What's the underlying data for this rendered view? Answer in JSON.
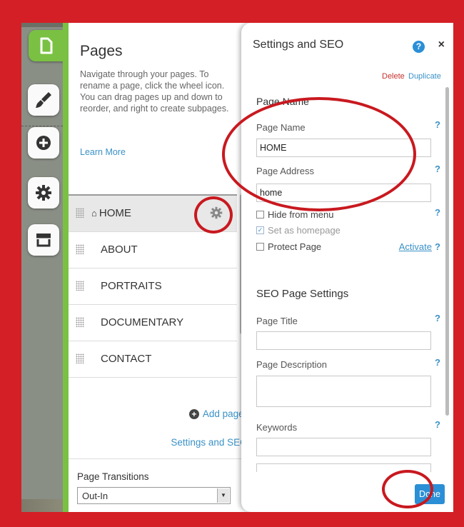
{
  "rail": {
    "items": [
      {
        "name": "pages-icon",
        "active": true
      },
      {
        "name": "design-icon"
      },
      {
        "name": "add-icon"
      },
      {
        "name": "settings-gear-icon"
      },
      {
        "name": "store-icon"
      }
    ]
  },
  "pages_panel": {
    "title": "Pages",
    "close": "×",
    "description": "Navigate through your pages. To rename a page, click the wheel icon. You can drag pages up and down to reorder, and right to create subpages.",
    "learn_more": "Learn More",
    "items": [
      {
        "label": "HOME",
        "home": true,
        "selected": true
      },
      {
        "label": "ABOUT"
      },
      {
        "label": "PORTRAITS"
      },
      {
        "label": "DOCUMENTARY"
      },
      {
        "label": "CONTACT"
      }
    ],
    "home_icon": "⌂",
    "add_page": "Add page",
    "settings_seo": "Settings and SEO",
    "chevron": "›",
    "transitions_label": "Page Transitions",
    "transitions_help": "?",
    "transitions_value": "Out-In"
  },
  "settings_panel": {
    "title": "Settings and SEO",
    "help": "?",
    "close": "×",
    "delete": "Delete",
    "duplicate": "Duplicate",
    "page_name_section": "Page Name",
    "page_name_label": "Page Name",
    "page_name_value": "HOME",
    "page_address_label": "Page Address",
    "page_address_value": "home",
    "hide_from_menu": "Hide from menu",
    "set_as_homepage": "Set as homepage",
    "protect_page": "Protect Page",
    "activate": "Activate",
    "seo_section": "SEO Page Settings",
    "page_title_label": "Page Title",
    "page_description_label": "Page Description",
    "keywords_label": "Keywords",
    "q": "?",
    "done": "Done"
  },
  "colors": {
    "frame_red": "#d41f26",
    "accent_green": "#7ac143",
    "link_blue": "#3a91c7",
    "done_blue": "#2b8fd6",
    "delete_red": "#c5322e"
  }
}
